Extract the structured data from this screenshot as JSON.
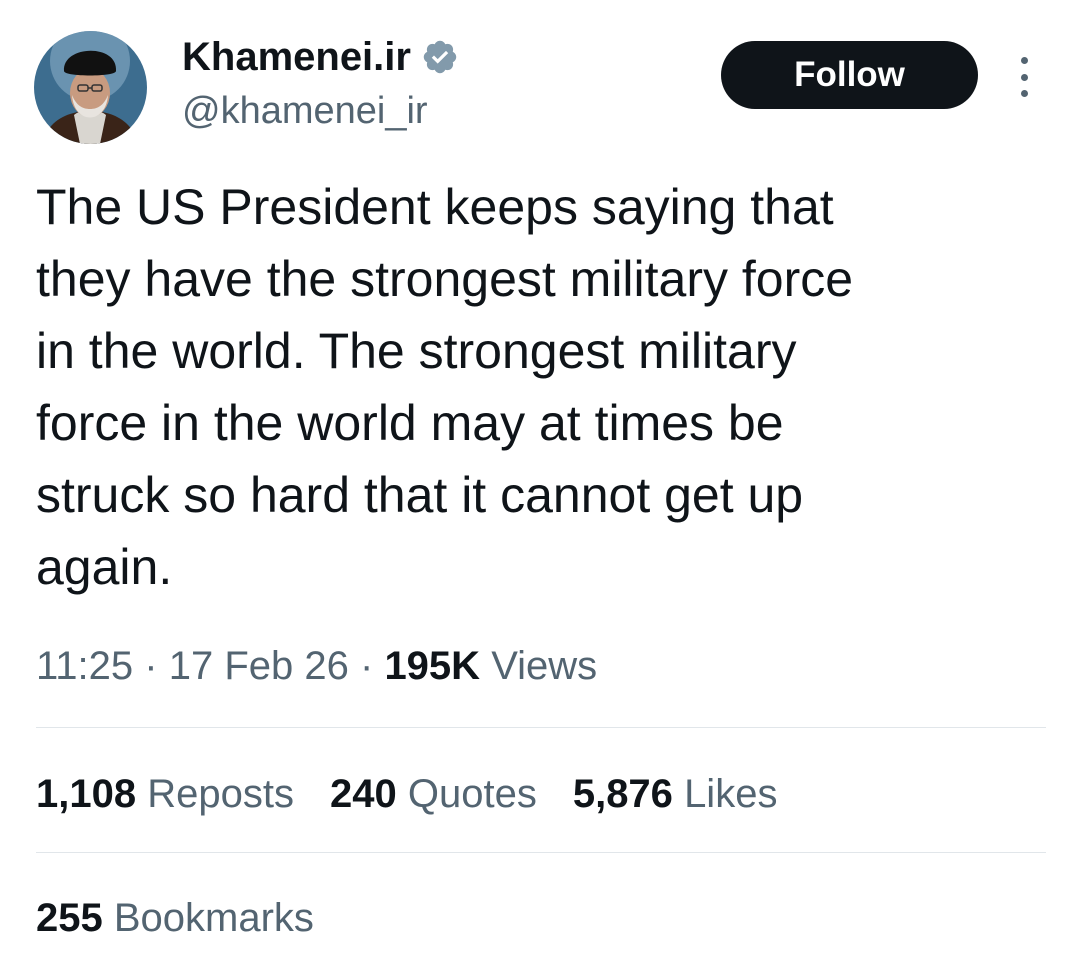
{
  "author": {
    "display_name": "Khamenei.ir",
    "handle": "@khamenei_ir",
    "verified": true,
    "avatar_icon": "avatar-portrait"
  },
  "actions": {
    "follow_label": "Follow",
    "more_icon": "more-vertical-icon"
  },
  "tweet": {
    "text": "The US President keeps saying that\nthey have the strongest military force\nin the world. The strongest military\nforce in the world may at times be\nstruck so hard that it cannot get up\nagain."
  },
  "meta": {
    "time": "11:25",
    "separator": "·",
    "date": "17 Feb 26",
    "views_count": "195K",
    "views_label": "Views"
  },
  "stats": {
    "reposts_count": "1,108",
    "reposts_label": "Reposts",
    "quotes_count": "240",
    "quotes_label": "Quotes",
    "likes_count": "5,876",
    "likes_label": "Likes",
    "bookmarks_count": "255",
    "bookmarks_label": "Bookmarks"
  },
  "colors": {
    "text_primary": "#0f1419",
    "text_secondary": "#536471",
    "follow_bg": "#0f1419",
    "verified_badge": "#829aab",
    "divider": "#e1e6ea"
  }
}
